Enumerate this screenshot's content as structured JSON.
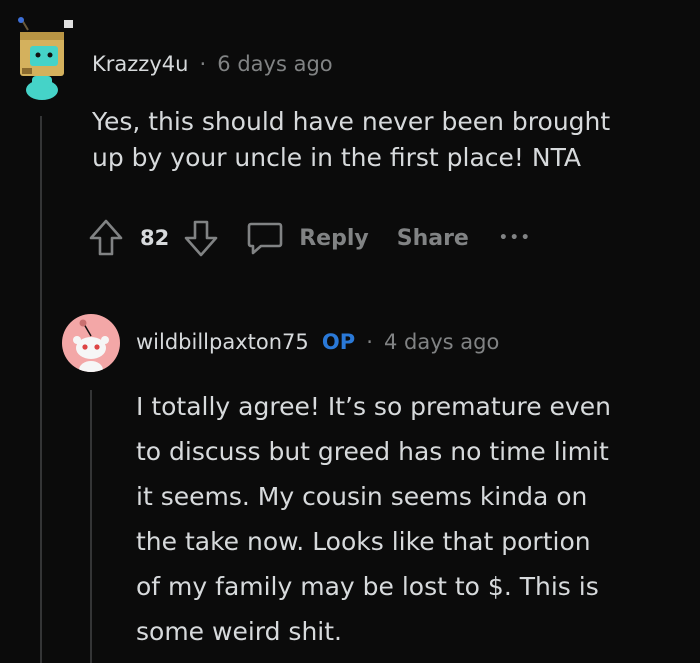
{
  "comment1": {
    "username": "Krazzy4u",
    "separator": "·",
    "timestamp": "6 days ago",
    "body_line1": "Yes, this should have never been brought",
    "body_line2": "up by your uncle in the first place! NTA",
    "votes": "82",
    "reply_label": "Reply",
    "share_label": "Share",
    "more_label": "•••"
  },
  "comment2": {
    "username": "wildbillpaxton75",
    "op_badge": "OP",
    "separator": "·",
    "timestamp": "4 days ago",
    "body_lines": [
      "I totally agree! It’s so premature even",
      "to discuss but greed has no time limit",
      "it seems. My cousin seems kinda on",
      "the take now. Looks like that portion",
      "of my family may be lost to $. This is",
      "some weird shit."
    ]
  },
  "colors": {
    "background": "#0b0b0b",
    "text": "#d7dadc",
    "muted": "#818384",
    "op": "#2a79d8",
    "avatar2_bg": "#f3a7a7"
  }
}
